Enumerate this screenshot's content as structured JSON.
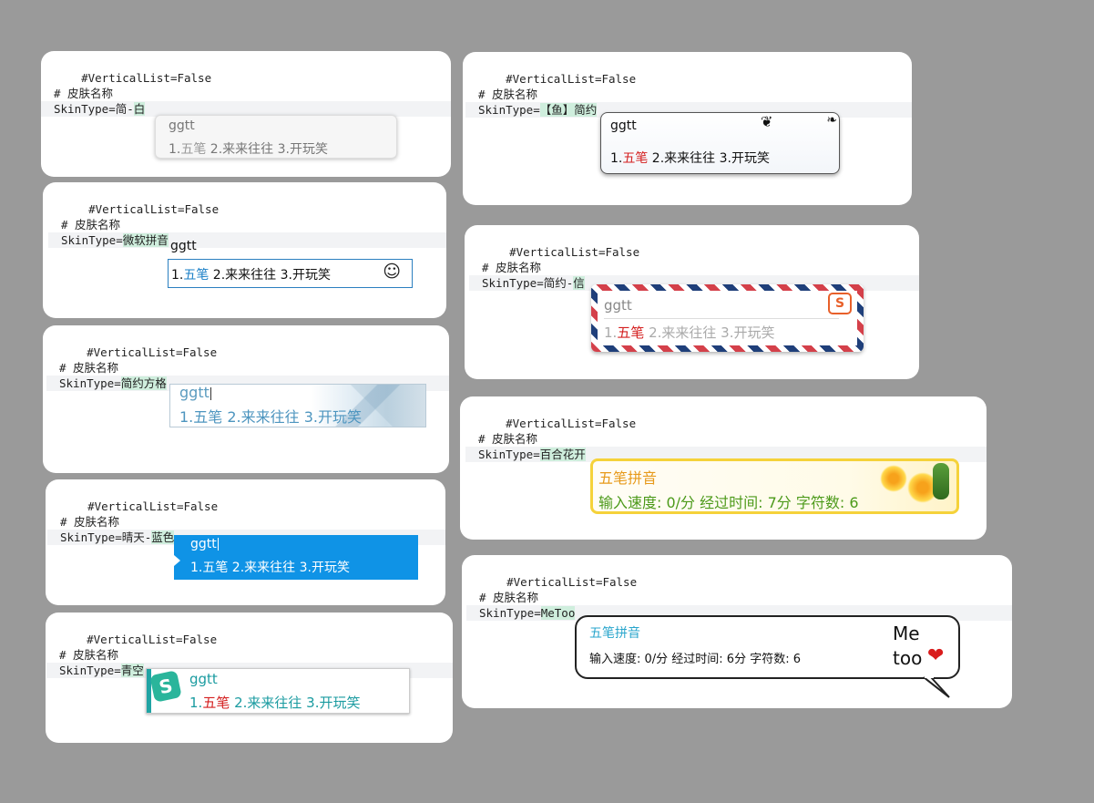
{
  "cards": [
    {
      "l1": "#VerticalList=False",
      "l2": "# 皮肤名称",
      "l3_prefix": "SkinType=",
      "l3_plain": "简-",
      "l3_hl": "白"
    },
    {
      "l1": "#VerticalList=False",
      "l2": "# 皮肤名称",
      "l3_prefix": "SkinType=",
      "l3_plain": "",
      "l3_hl": "微软拼音"
    },
    {
      "l1": "#VerticalList=False",
      "l2": "# 皮肤名称",
      "l3_prefix": "SkinType=",
      "l3_plain": "",
      "l3_hl": "简约方格"
    },
    {
      "l1": "#VerticalList=False",
      "l2": "# 皮肤名称",
      "l3_prefix": "SkinType=",
      "l3_plain": "晴天-",
      "l3_hl": "蓝色"
    },
    {
      "l1": "#VerticalList=False",
      "l2": "# 皮肤名称",
      "l3_prefix": "SkinType=",
      "l3_plain": "",
      "l3_hl": "青空"
    },
    {
      "l1": "#VerticalList=False",
      "l2": "# 皮肤名称",
      "l3_prefix": "SkinType=",
      "l3_plain": "",
      "l3_hl": "【鱼】简约"
    },
    {
      "l1": "#VerticalList=False",
      "l2": "# 皮肤名称",
      "l3_prefix": "SkinType=",
      "l3_plain": "简约-",
      "l3_hl": "信"
    },
    {
      "l1": "#VerticalList=False",
      "l2": "# 皮肤名称",
      "l3_prefix": "SkinType=",
      "l3_plain": "",
      "l3_hl": "百合花开"
    },
    {
      "l1": "#VerticalList=False",
      "l2": "# 皮肤名称",
      "l3_prefix": "SkinType=",
      "l3_plain": "",
      "l3_hl": "MeToo"
    }
  ],
  "ime": {
    "composition": "ggtt",
    "cand_num1": "1.",
    "cand_word1": "五笔",
    "cand_rest": " 2.来来往往 3.开玩笑",
    "typing_title": "五笔拼音",
    "typing_stats_lily": "输入速度: 0/分  经过时间: 7分  字符数: 6",
    "typing_stats_metoo": "输入速度: 0/分  经过时间: 6分  字符数: 6",
    "metoo_line1": "Me",
    "metoo_line2": "too",
    "smiley": "☺",
    "heart": "❤",
    "sogou_s": "S"
  }
}
